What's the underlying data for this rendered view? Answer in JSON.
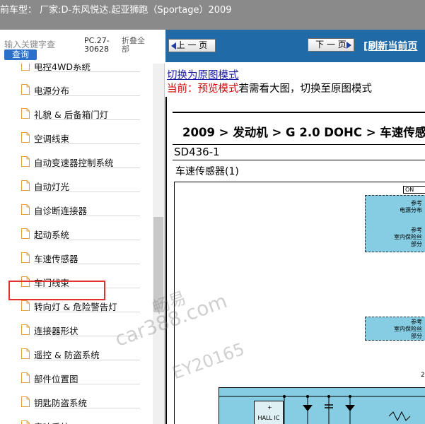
{
  "window": {
    "title": "前车型：  厂家:D-东风悦达.起亚狮跑（Sportage）2009"
  },
  "search": {
    "placeholder": "输入关键字查",
    "button_label": "查询",
    "code": "PC.27-30628",
    "collapse_label": "折叠全部"
  },
  "tree": {
    "items": [
      {
        "label": "电控4WD系统"
      },
      {
        "label": "电源分布"
      },
      {
        "label": "礼貌 & 后备箱门灯"
      },
      {
        "label": "空调线束"
      },
      {
        "label": "自动变速器控制系统"
      },
      {
        "label": "自动灯光"
      },
      {
        "label": "自诊断连接器"
      },
      {
        "label": "起动系统"
      },
      {
        "label": "车速传感器"
      },
      {
        "label": "车门线束"
      },
      {
        "label": "转向灯 & 危险警告灯"
      },
      {
        "label": "连接器形状"
      },
      {
        "label": "遥控 & 防盗系统"
      },
      {
        "label": "部件位置图"
      },
      {
        "label": "钥匙防盗系统"
      },
      {
        "label": "音响系统"
      }
    ],
    "selected_index": 8
  },
  "nav": {
    "prev_label": "上 一 页",
    "next_label": "下 一 页",
    "refresh_label": "[刷新当前页"
  },
  "content": {
    "switch_link": "切换为原图模式",
    "mode_current": "当前：预览模式",
    "mode_hint": "若需看大图，切换至原图模式",
    "heading": "2009 > 发动机 > G 2.0 DOHC > 车速传感",
    "doc_code": "SD436-1",
    "subtitle": "车速传感器(1)"
  },
  "diagram": {
    "on_label": "ON",
    "ref1_top": "参考\n电源分布",
    "ref1_bottom": "参考\n室内保险丝\n部分",
    "ref2": "参考\n室内保险丝\n部分",
    "page_fragment": "2",
    "hall_ic": "HALL IC",
    "plus": "+"
  },
  "watermark": {
    "line1": "畅易",
    "line2": "car388.com",
    "line3": "EY20165"
  },
  "colors": {
    "titlebar": "#8a8a8a",
    "navbar": "#1f6aa7",
    "diagram_fill": "#86cde4",
    "highlight": "#e03030",
    "link": "#1a1aa6",
    "mode_red": "#d00000"
  }
}
